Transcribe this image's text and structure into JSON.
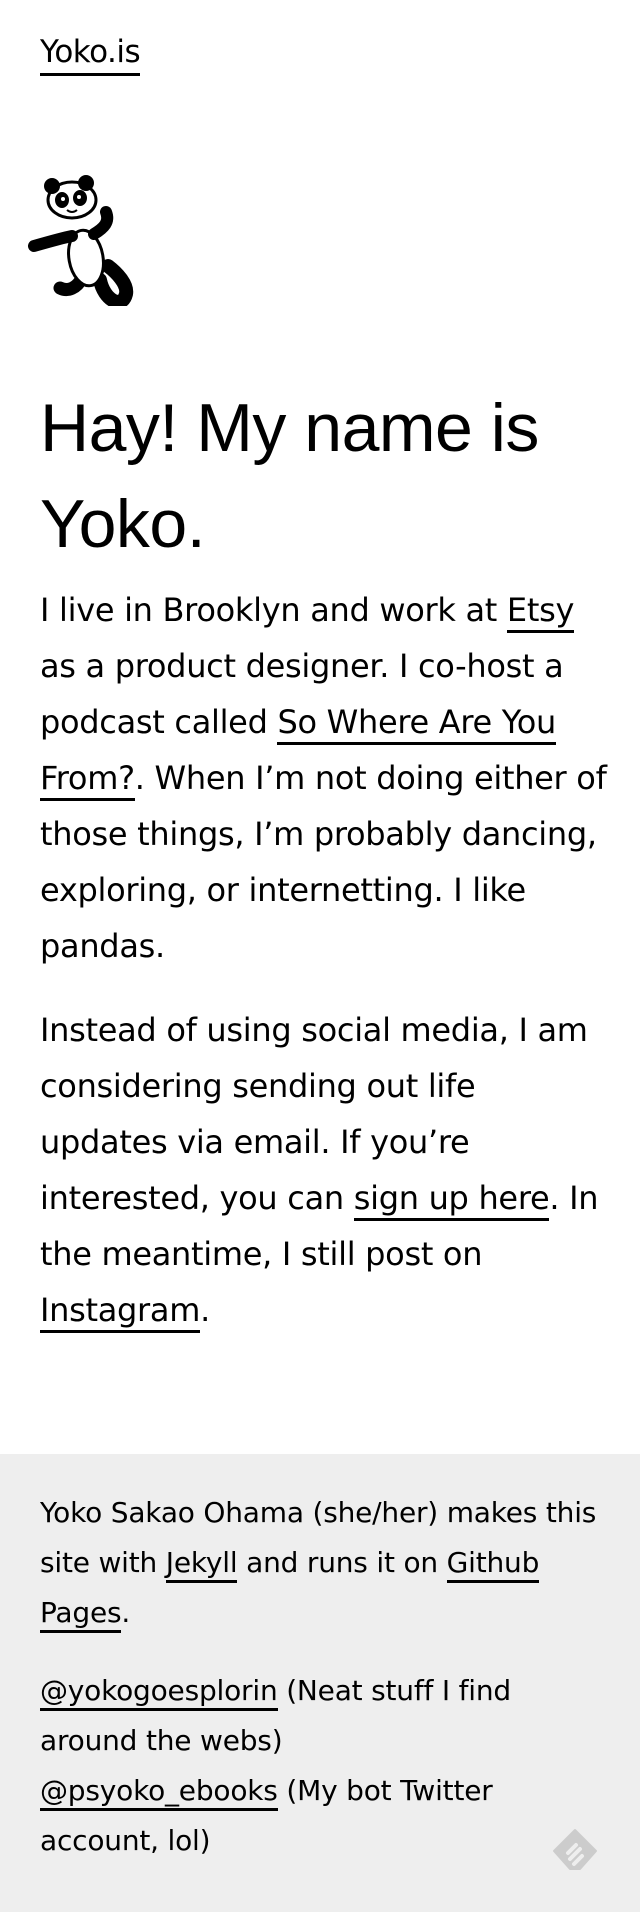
{
  "header": {
    "site_title": "Yoko.is"
  },
  "intro": {
    "headline": "Hay! My name is Yoko.",
    "p1_before_etsy": "I live in Brooklyn and work at ",
    "etsy_link": "Etsy",
    "p1_after_etsy": " as a product designer. I co-host a podcast called ",
    "podcast_link": "So Where Are You From?",
    "p1_after_podcast": ". When I’m not doing either of those things, I’m probably dancing, exploring, or internetting. I like pandas.",
    "p2_before_signup": "Instead of using social media, I am considering sending out life updates via email. If you’re interested, you can ",
    "signup_link": "sign up here",
    "p2_after_signup": ". In the meantime, I still post on ",
    "instagram_link": "Instagram",
    "p2_end": "."
  },
  "footer": {
    "credits_before_jekyll": "Yoko Sakao Ohama (she/her) makes this site with ",
    "jekyll_link": "Jekyll",
    "credits_middle": " and runs it on ",
    "github_link": "Github Pages",
    "credits_end": ".",
    "twitter1_link": "@yokogoesplorin",
    "twitter1_desc": " (Neat stuff I find around the webs)",
    "twitter2_link": "@psyoko_ebooks",
    "twitter2_desc": " (My bot Twitter account, lol)"
  },
  "icons": {
    "panda": "panda-illustration",
    "feed": "feedly-icon"
  },
  "colors": {
    "text": "#000000",
    "footer_bg": "#eeeeee",
    "feed_icon": "#cccccc"
  }
}
